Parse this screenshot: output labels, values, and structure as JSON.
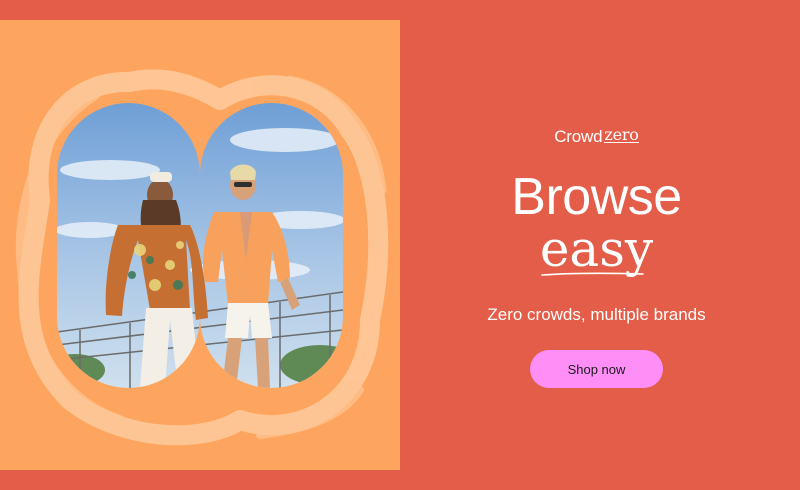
{
  "brand": {
    "part_a": "Crowd",
    "part_b": "zero"
  },
  "hero": {
    "headline": "Browse",
    "headline_script": "easy",
    "tagline": "Zero crowds, multiple brands",
    "cta_label": "Shop now"
  },
  "colors": {
    "background": "#e35d48",
    "panel": "#fda55e",
    "cta": "#ff8ef7",
    "text": "#ffffff"
  }
}
